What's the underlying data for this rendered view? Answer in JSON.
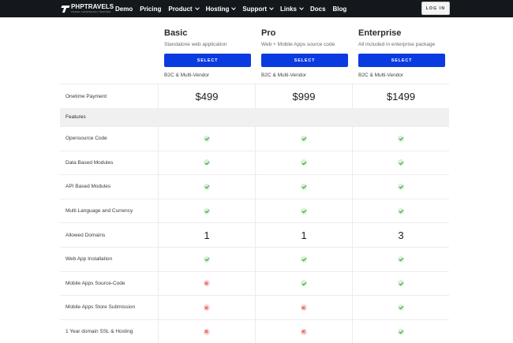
{
  "nav": {
    "logo_name": "PHPTRAVELS",
    "logo_tagline": "TRAVEL TECHNOLOGY PARTNER",
    "items": [
      {
        "label": "Demo",
        "dropdown": false
      },
      {
        "label": "Pricing",
        "dropdown": false
      },
      {
        "label": "Product",
        "dropdown": true
      },
      {
        "label": "Hosting",
        "dropdown": true
      },
      {
        "label": "Support",
        "dropdown": true
      },
      {
        "label": "Links",
        "dropdown": true
      },
      {
        "label": "Docs",
        "dropdown": false
      },
      {
        "label": "Blog",
        "dropdown": false
      }
    ],
    "login_label": "LOG IN"
  },
  "plans": [
    {
      "name": "Basic",
      "description": "Standalone web application",
      "select_label": "SELECT",
      "type": "B2C & Multi-Vendor"
    },
    {
      "name": "Pro",
      "description": "Web + Mobile Apps source code",
      "select_label": "SELECT",
      "type": "B2C & Multi-Vendor"
    },
    {
      "name": "Enterprise",
      "description": "All included in enterprise package",
      "select_label": "SELECT",
      "type": "B2C & Multi-Vendor"
    }
  ],
  "colors": {
    "nav_bg": "#14181c",
    "select_button": "#0a3be0",
    "check": "#2e9e3b",
    "cross": "#e04848",
    "section_bg": "#f0f0f0"
  },
  "table": {
    "price_row": {
      "label": "Onetime Payment",
      "values": [
        "$499",
        "$999",
        "$1499"
      ]
    },
    "section_label": "Features",
    "features": [
      {
        "label": "Opensource Code",
        "values": [
          "check",
          "check",
          "check"
        ]
      },
      {
        "label": "Data Based Modules",
        "values": [
          "check",
          "check",
          "check"
        ]
      },
      {
        "label": "API Based Modules",
        "values": [
          "check",
          "check",
          "check"
        ]
      },
      {
        "label": "Multi Language and Currency",
        "values": [
          "check",
          "check",
          "check"
        ]
      },
      {
        "label": "Allowed Domains",
        "values": [
          "1",
          "1",
          "3"
        ]
      },
      {
        "label": "Web App Installation",
        "values": [
          "check",
          "check",
          "check"
        ]
      },
      {
        "label": "Mobile Apps Source-Code",
        "values": [
          "cross",
          "check",
          "check"
        ]
      },
      {
        "label": "Mobile Apps Store Submission",
        "values": [
          "cross",
          "cross",
          "check"
        ]
      },
      {
        "label": "1 Year domain SSL & Hosting",
        "values": [
          "cross",
          "cross",
          "check"
        ]
      }
    ]
  }
}
